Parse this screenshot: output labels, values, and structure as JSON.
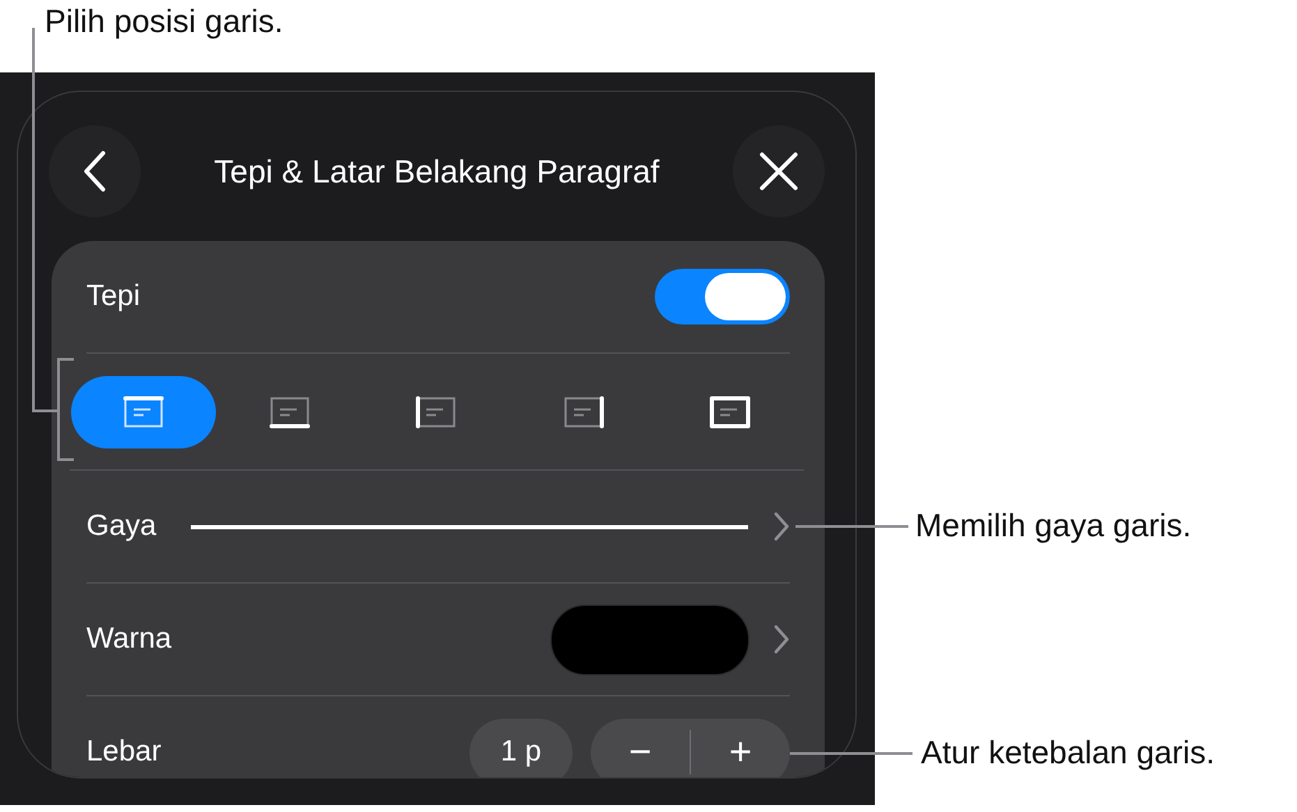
{
  "callouts": [
    {
      "text": "Pilih posisi garis."
    },
    {
      "text": "Memilih gaya garis."
    },
    {
      "text": "Atur ketebalan garis."
    }
  ],
  "header": {
    "title": "Tepi & Latar Belakang Paragraf"
  },
  "border": {
    "label": "Tepi",
    "on": true
  },
  "positions": [
    {
      "kind": "top",
      "selected": true
    },
    {
      "kind": "bottom",
      "selected": false
    },
    {
      "kind": "left",
      "selected": false
    },
    {
      "kind": "right",
      "selected": false
    },
    {
      "kind": "all",
      "selected": false
    }
  ],
  "rows": [
    {
      "kind": "style",
      "label": "Gaya"
    },
    {
      "kind": "color",
      "label": "Warna",
      "color": "#000000"
    },
    {
      "kind": "width",
      "label": "Lebar",
      "value": "1 p",
      "minus": "−",
      "plus": "+"
    }
  ]
}
